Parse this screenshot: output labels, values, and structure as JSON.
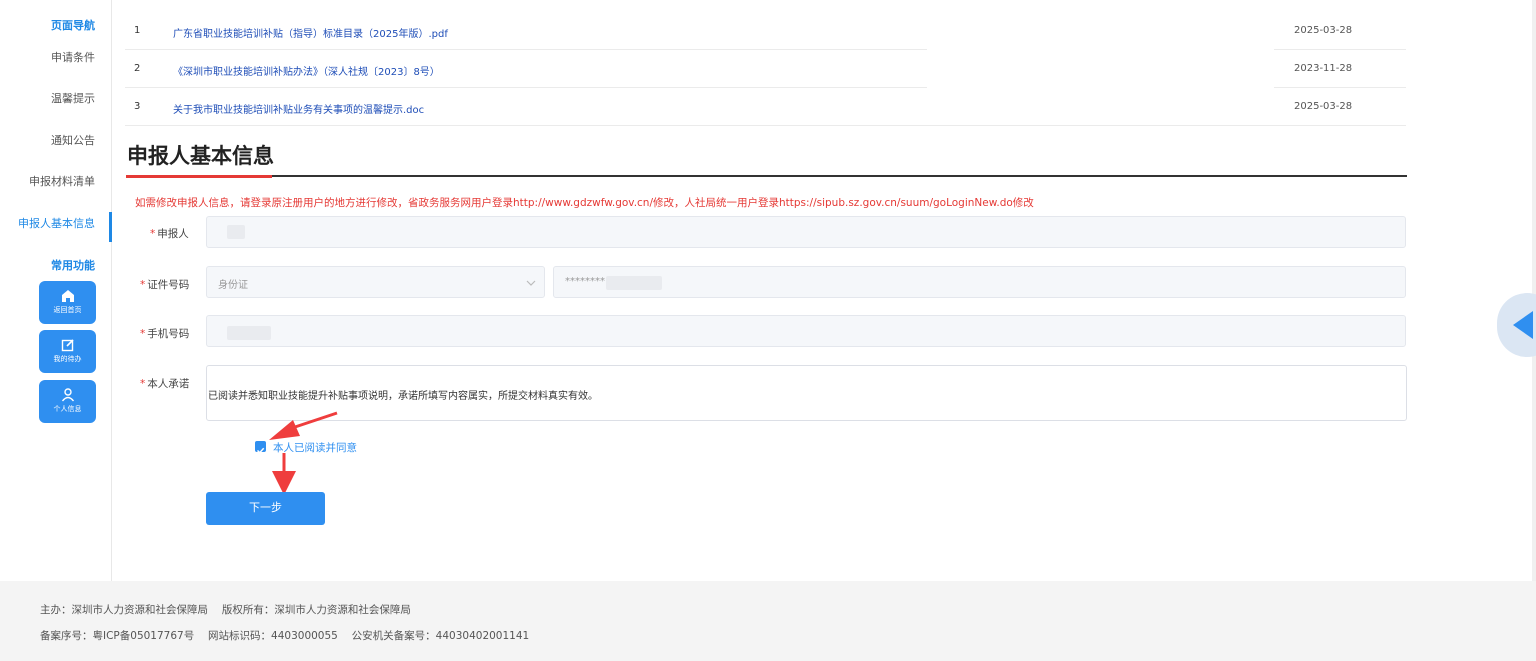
{
  "sidebar": {
    "nav_heading": "页面导航",
    "items": [
      {
        "label": "申请条件"
      },
      {
        "label": "温馨提示"
      },
      {
        "label": "通知公告"
      },
      {
        "label": "申报材料清单"
      },
      {
        "label": "申报人基本信息"
      }
    ],
    "common_heading": "常用功能",
    "quick_buttons": [
      {
        "label": "返回首页",
        "icon": "home-icon"
      },
      {
        "label": "我的待办",
        "icon": "edit-icon"
      },
      {
        "label": "个人信息",
        "icon": "user-icon"
      }
    ]
  },
  "documents": [
    {
      "num": "1",
      "title": "广东省职业技能培训补贴（指导）标准目录（2025年版）.pdf",
      "date": "2025-03-28"
    },
    {
      "num": "2",
      "title": "《深圳市职业技能培训补贴办法》（深人社规〔2023〕8号）",
      "date": "2023-11-28"
    },
    {
      "num": "3",
      "title": "关于我市职业技能培训补贴业务有关事项的温馨提示.doc",
      "date": "2025-03-28"
    }
  ],
  "section": {
    "title": "申报人基本信息",
    "notice": "如需修改申报人信息，请登录原注册用户的地方进行修改，省政务服务网用户登录http://www.gdzwfw.gov.cn/修改，人社局统一用户登录https://sipub.sz.gov.cn/suum/goLoginNew.do修改"
  },
  "form": {
    "applicant_label": "申报人",
    "id_label": "证件号码",
    "id_type": "身份证",
    "id_number_masked": "********",
    "phone_label": "手机号码",
    "promise_label": "本人承诺",
    "promise_text": "已阅读并悉知职业技能提升补贴事项说明，承诺所填写内容属实，所提交材料真实有效。",
    "agree_label": "本人已阅读并同意",
    "agree_checked": true,
    "next_label": "下一步"
  },
  "footer": {
    "line1": "主办：深圳市人力资源和社会保障局　 版权所有：深圳市人力资源和社会保障局",
    "line2": "备案序号：粤ICP备05017767号　 网站标识码：4403000055　 公安机关备案号：44030402001141"
  },
  "colors": {
    "accent": "#2f8ff0",
    "warning": "#e53935",
    "link": "#1e4db7"
  }
}
